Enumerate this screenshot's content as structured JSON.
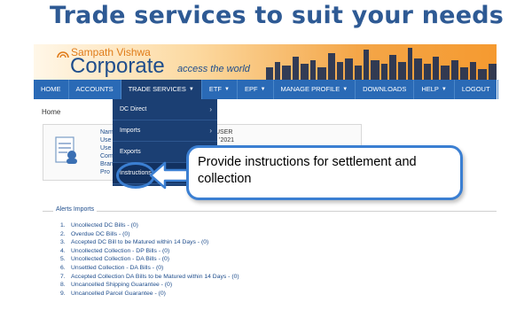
{
  "slide_title": "Trade services to suit your needs",
  "brand": {
    "bank_name": "Sampath Vishwa",
    "product": "Corporate",
    "tagline": "access the world"
  },
  "nav": {
    "items": [
      "HOME",
      "ACCOUNTS",
      "TRADE SERVICES",
      "ETF",
      "EPF",
      "MANAGE PROFILE",
      "DOWNLOADS"
    ],
    "right_items": [
      "HELP",
      "LOGOUT"
    ]
  },
  "breadcrumb": "Home",
  "profile": {
    "labels": [
      "Nam",
      "Use",
      "Use",
      "Com",
      "Bran",
      "Pro"
    ],
    "value": "USER",
    "value2": "/ ’2021"
  },
  "trade_menu": {
    "items": [
      "DC Direct",
      "Imports",
      "Exports",
      "Instructions"
    ]
  },
  "callout_text": "Provide instructions for settlement and collection",
  "alerts": {
    "legend": "Alerts Imports",
    "items": [
      "Uncollected DC Bills - (0)",
      "Overdue DC Bills - (0)",
      "Accepted DC Bill to be Matured within 14 Days - (0)",
      "Uncollected Collection - DP Bills - (0)",
      "Uncollected Collection - DA Bills - (0)",
      "Unsettled Collection - DA Bills - (0)",
      "Accepted Collection DA Bills to be Matured within 14 Days - (0)",
      "Uncancelled Shipping Guarantee - (0)",
      "Uncancelled Parcel Guarantee - (0)"
    ]
  },
  "colors": {
    "title": "#2e5a94",
    "navbar": "#2a6ab6",
    "menu": "#1b3f73",
    "callout_border": "#3b7fd2"
  }
}
